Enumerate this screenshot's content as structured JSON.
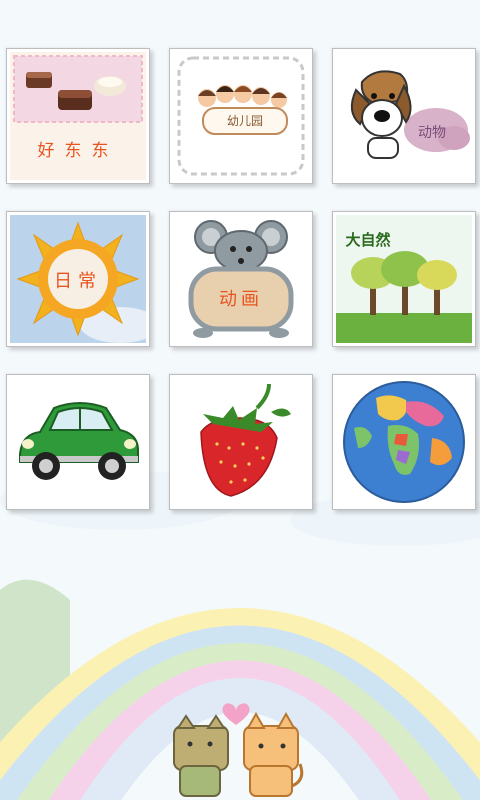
{
  "categories": [
    {
      "id": "goodies",
      "label": "好东东",
      "icon": "chocolates"
    },
    {
      "id": "kindergarten",
      "label": "幼儿园",
      "icon": "children-group"
    },
    {
      "id": "animals",
      "label": "动物",
      "icon": "puppy"
    },
    {
      "id": "daily",
      "label": "日常",
      "icon": "sun"
    },
    {
      "id": "cartoon",
      "label": "动画",
      "icon": "mouse"
    },
    {
      "id": "nature",
      "label": "大自然",
      "icon": "trees"
    },
    {
      "id": "vehicles",
      "label": "",
      "icon": "green-car"
    },
    {
      "id": "fruits",
      "label": "",
      "icon": "strawberry"
    },
    {
      "id": "world",
      "label": "",
      "icon": "globe"
    }
  ],
  "colors": {
    "label_red": "#e8541f",
    "label_orange": "#d97a2b",
    "nature_green": "#5fb23a"
  }
}
